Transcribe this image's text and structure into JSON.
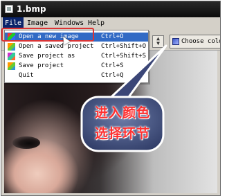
{
  "window": {
    "title": "1.bmp"
  },
  "menubar": {
    "items": [
      {
        "label": "File"
      },
      {
        "label": "Image"
      },
      {
        "label": "Windows"
      },
      {
        "label": "Help"
      }
    ]
  },
  "file_menu": {
    "items": [
      {
        "label": "Open a new image",
        "shortcut": "Ctrl+O"
      },
      {
        "label": "Open a saved project",
        "shortcut": "Ctrl+Shift+O"
      },
      {
        "label": "Save project as",
        "shortcut": "Ctrl+Shift+S"
      },
      {
        "label": "Save project",
        "shortcut": "Ctrl+S"
      },
      {
        "label": "Quit",
        "shortcut": "Ctrl+Q"
      }
    ]
  },
  "toolbar": {
    "choose_colors_label": "Choose colors"
  },
  "callout": {
    "line1": "进入颜色",
    "line2": "选择环节"
  },
  "colors": {
    "highlight_border": "#dd3333",
    "callout_text": "#ff3030",
    "menu_selection": "#316ac5"
  }
}
